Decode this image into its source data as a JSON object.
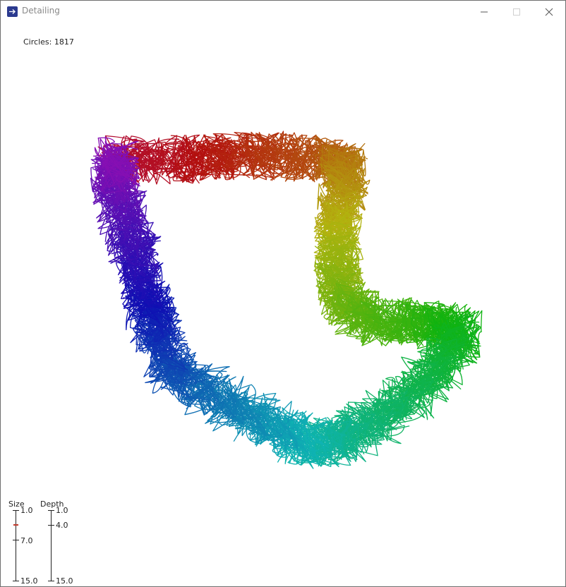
{
  "window": {
    "title": "Detailing",
    "icon": "arrow-right-icon",
    "controls": [
      "minimize-icon",
      "maximize-icon",
      "close-icon"
    ]
  },
  "stats": {
    "circles_label": "Circles:",
    "circles_value": "1817"
  },
  "sliders": {
    "size": {
      "label": "Size",
      "ticks": [
        "1.0",
        "7.0",
        "15.0"
      ],
      "min": 1.0,
      "max": 15.0,
      "value": 2.5
    },
    "depth": {
      "label": "Depth",
      "ticks": [
        "1.0",
        "4.0",
        "15.0"
      ],
      "min": 1.0,
      "max": 15.0,
      "value": 4.0
    }
  },
  "colors": {
    "accent": "#c0392b",
    "gradient_red": "#c0102a",
    "gradient_yellow": "#e0d800",
    "gradient_green": "#2aa000",
    "gradient_cyan": "#00b4c0",
    "gradient_blue": "#141aa0",
    "gradient_magenta": "#c800c8"
  }
}
